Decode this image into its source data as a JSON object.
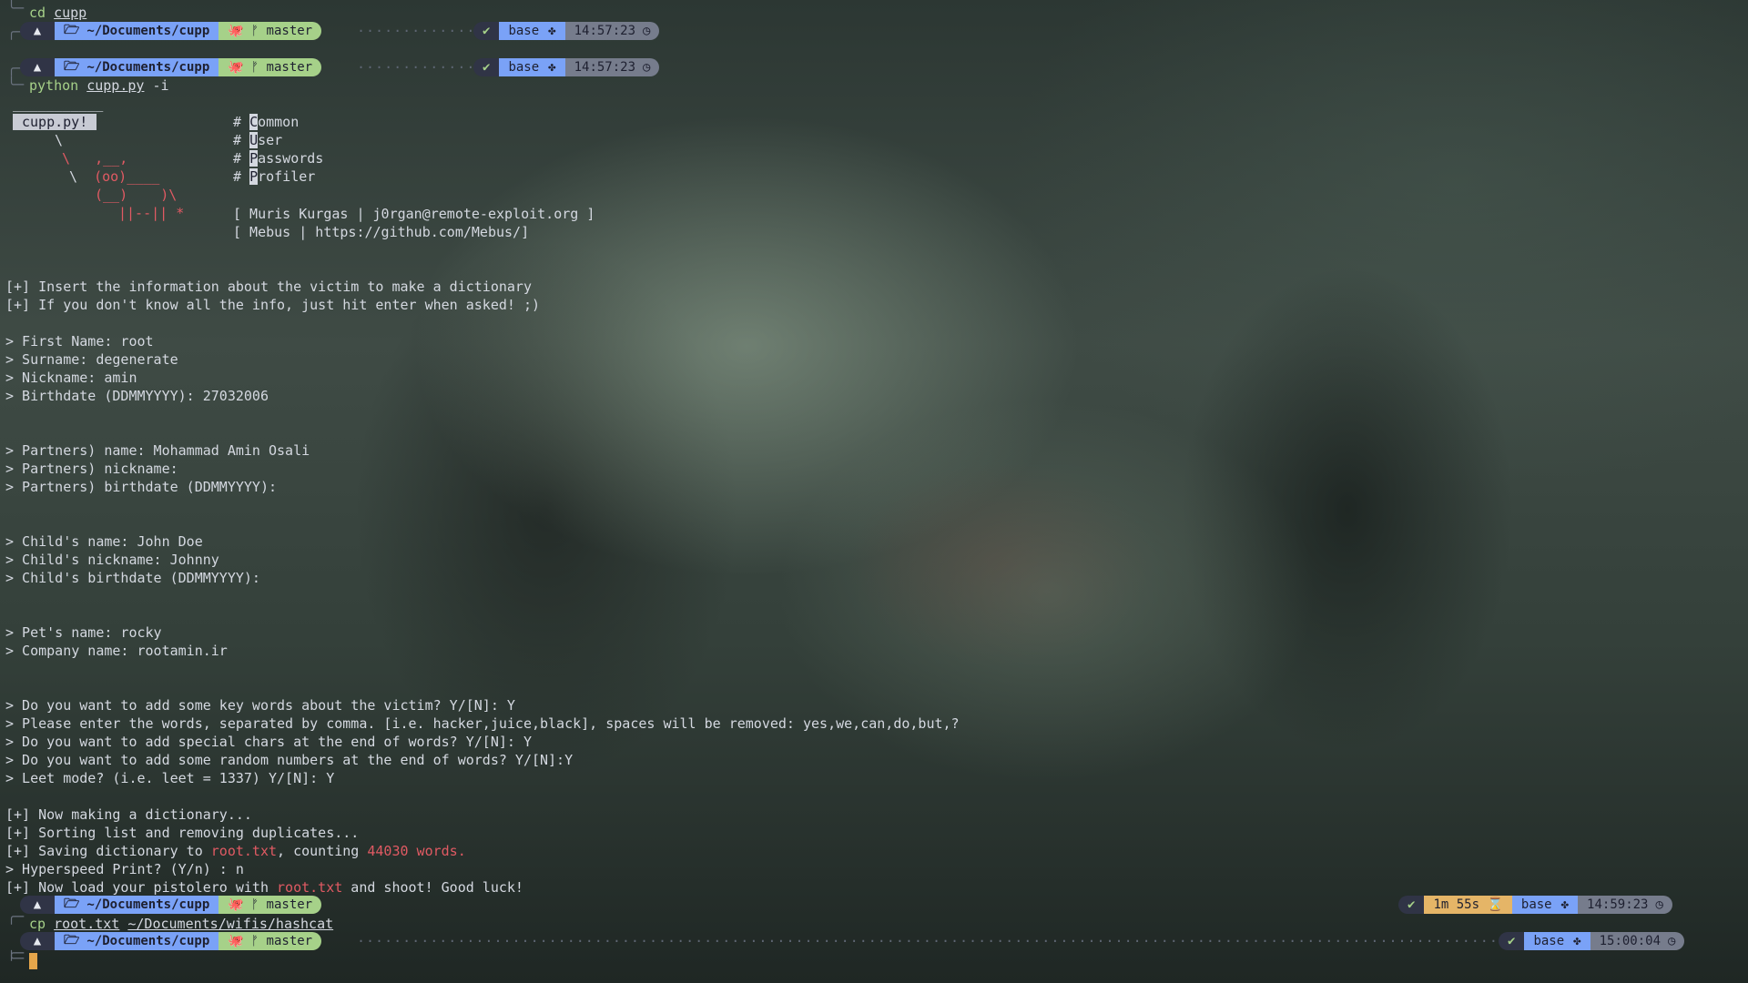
{
  "prompt": {
    "arch_icon": "▲",
    "folder_icon": "🗁",
    "dir": "~/Documents/",
    "dir_bold": "cupp",
    "git_icon": "🐙",
    "branch_icon": "ᚠ",
    "branch": "master",
    "ok_icon": "✔",
    "env": "base",
    "env_icon": "✤",
    "clock_icon": "◷",
    "hourglass_icon": "⌛"
  },
  "prompt_times": [
    "14:57:23",
    "14:57:23",
    "14:59:23",
    "15:00:04"
  ],
  "duration": "1m 55s",
  "commands": {
    "cmd1_name": "cd",
    "cmd1_arg": "cupp",
    "cmd2_name": "python",
    "cmd2_arg": "cupp.py",
    "cmd2_flag": "-i",
    "cmd3_name": "cp",
    "cmd3_arg1": "root.txt",
    "cmd3_arg2": "~/Documents/wifis/hashcat"
  },
  "banner": {
    "top": "___________",
    "box": "cupp.py!",
    "l2": "\\",
    "l3": "\\   ,__,",
    "l4a": "\\  ",
    "l4b": "(oo)____",
    "l5": "(__)    )\\",
    "l6": "||--|| *",
    "hash": "#",
    "words": [
      [
        "C",
        "ommon"
      ],
      [
        "U",
        "ser"
      ],
      [
        "P",
        "asswords"
      ],
      [
        "P",
        "rofiler"
      ]
    ],
    "author1": "[ Muris Kurgas | j0rgan@remote-exploit.org ]",
    "author2": "[ Mebus | https://github.com/Mebus/]"
  },
  "output": [
    "[+] Insert the information about the victim to make a dictionary",
    "[+] If you don't know all the info, just hit enter when asked! ;)",
    "> First Name: root",
    "> Surname: degenerate",
    "> Nickname: amin",
    "> Birthdate (DDMMYYYY): 27032006",
    "> Partners) name: Mohammad Amin Osali",
    "> Partners) nickname:",
    "> Partners) birthdate (DDMMYYYY):",
    "> Child's name: John Doe",
    "> Child's nickname: Johnny",
    "> Child's birthdate (DDMMYYYY):",
    "> Pet's name: rocky",
    "> Company name: rootamin.ir",
    "> Do you want to add some key words about the victim? Y/[N]: Y",
    "> Please enter the words, separated by comma. [i.e. hacker,juice,black], spaces will be removed: yes,we,can,do,but,?",
    "> Do you want to add special chars at the end of words? Y/[N]: Y",
    "> Do you want to add some random numbers at the end of words? Y/[N]:Y",
    "> Leet mode? (i.e. leet = 1337) Y/[N]: Y",
    "[+] Now making a dictionary...",
    "[+] Sorting list and removing duplicates...",
    "> Hyperspeed Print? (Y/n) : n"
  ],
  "saving": {
    "pre": "[+] Saving dictionary to ",
    "file": "root.txt",
    "mid": ", counting ",
    "count": "44030 words."
  },
  "load": {
    "pre": "[+] Now load your pistolero with ",
    "file": "root.txt",
    "post": " and shoot! Good luck!"
  },
  "colors": {
    "dir_segment": "#7aa2f7",
    "git_segment": "#a6d189",
    "duration_segment": "#e5b567",
    "highlight_red": "#e05a63",
    "cursor": "#e5a64b"
  }
}
